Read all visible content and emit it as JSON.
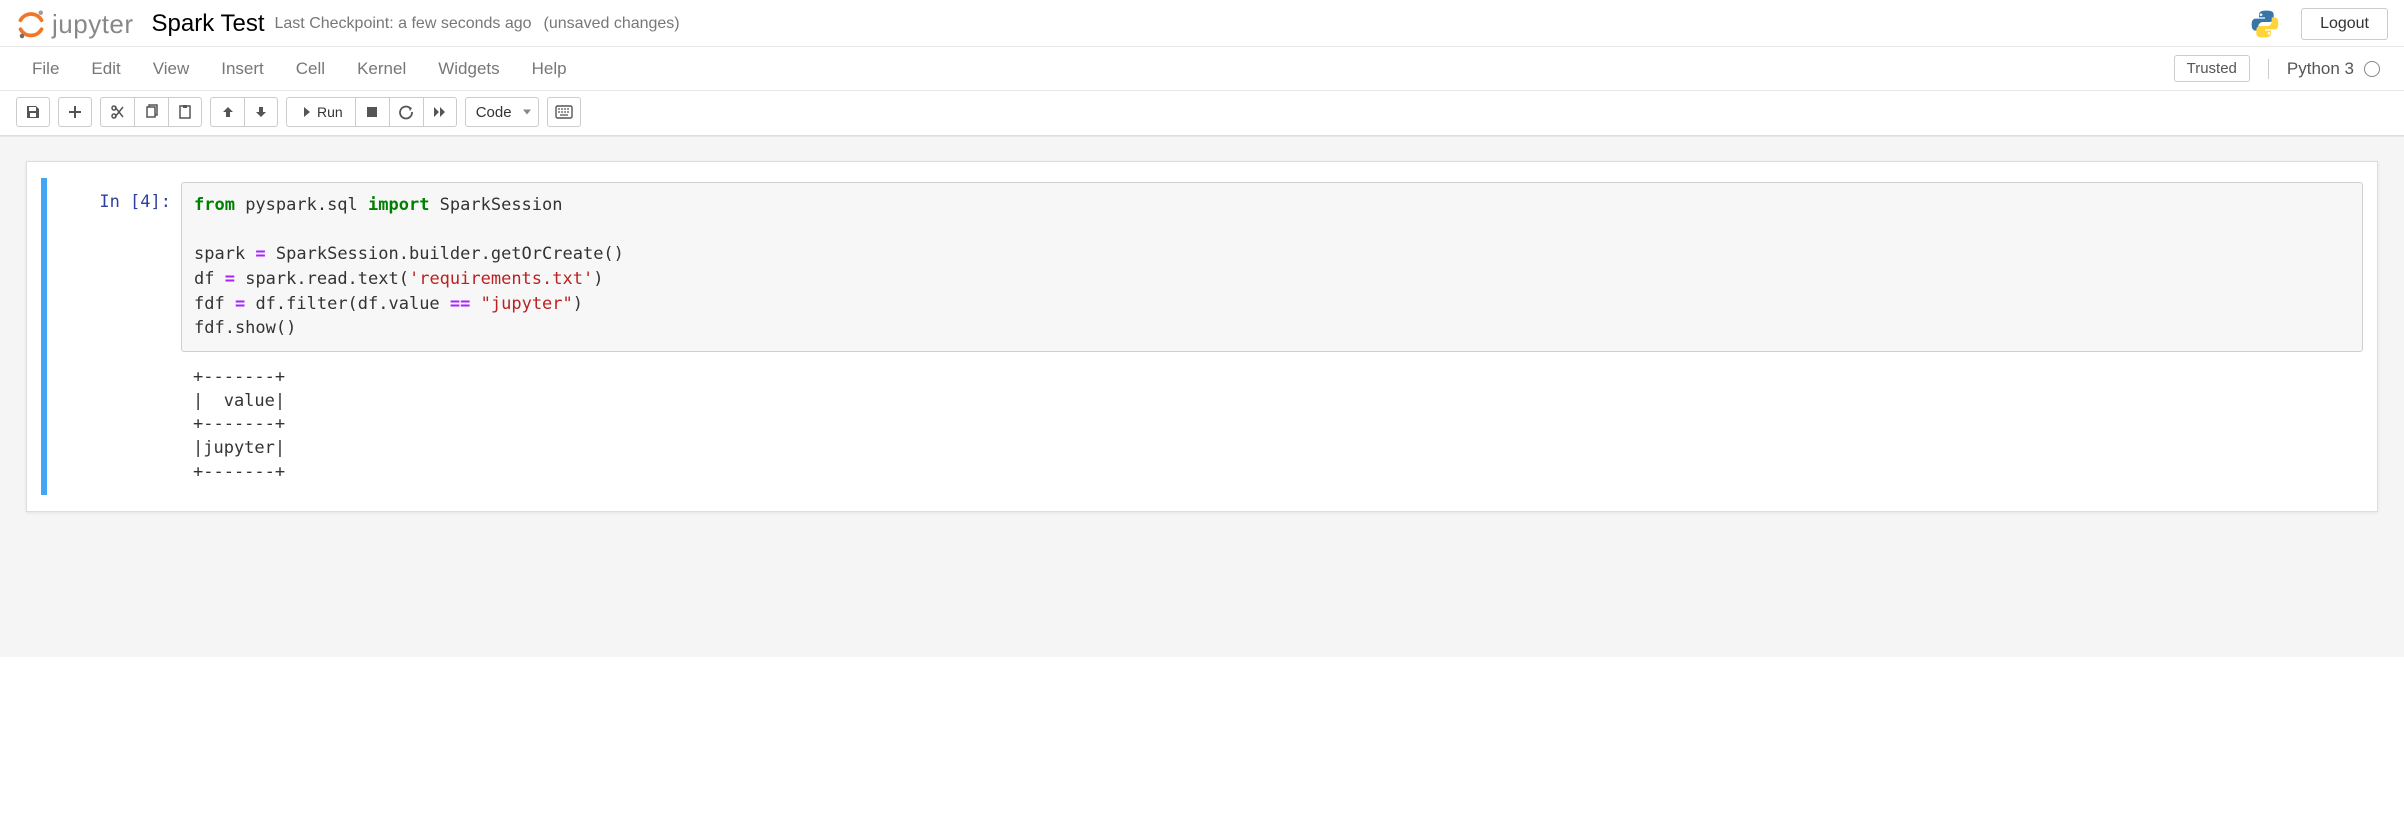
{
  "header": {
    "logo_text": "jupyter",
    "notebook_name": "Spark Test",
    "checkpoint": "Last Checkpoint: a few seconds ago",
    "unsaved": "(unsaved changes)",
    "logout": "Logout"
  },
  "menubar": {
    "items": [
      "File",
      "Edit",
      "View",
      "Insert",
      "Cell",
      "Kernel",
      "Widgets",
      "Help"
    ],
    "trusted": "Trusted",
    "kernel_name": "Python 3"
  },
  "toolbar": {
    "run_label": "Run",
    "cell_type_selected": "Code"
  },
  "cell": {
    "exec_count": 4,
    "prompt": "In [4]:",
    "code": {
      "l1": {
        "kw1": "from",
        "mod": " pyspark.sql ",
        "kw2": "import",
        "cls": " SparkSession"
      },
      "l3": {
        "a": "spark ",
        "op": "=",
        "b": " SparkSession.builder.getOrCreate()"
      },
      "l4": {
        "a": "df ",
        "op": "=",
        "b": " spark.read.text(",
        "str": "'requirements.txt'",
        "c": ")"
      },
      "l5": {
        "a": "fdf ",
        "op": "=",
        "b": " df.filter(df.value ",
        "op2": "==",
        "c": " ",
        "str": "\"jupyter\"",
        "d": ")"
      },
      "l6": "fdf.show()"
    },
    "output": "+-------+\n|  value|\n+-------+\n|jupyter|\n+-------+"
  }
}
